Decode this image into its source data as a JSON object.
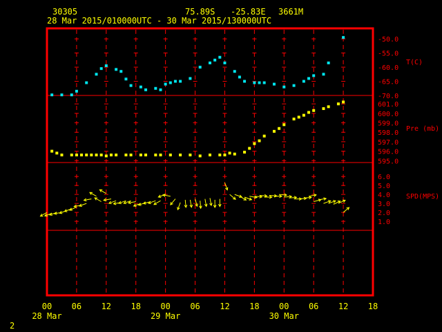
{
  "header": {
    "station_id": "30305",
    "lat": "75.89S",
    "lon": "-25.83E",
    "elevation": "3661M",
    "time_range": "28 Mar 2015/010000UTC - 30 Mar 2015/130000UTC"
  },
  "footer": {
    "page_number": "2"
  },
  "colors": {
    "background": "#000000",
    "frame": "#ff0000",
    "header_text": "#ffff00",
    "axis_text": "#ffff00",
    "temperature": "#00e5ee",
    "pressure": "#ffff00",
    "wind": "#ffff00"
  },
  "chart_data": {
    "type": "scatter",
    "x_unit": "hours since 28 Mar 2015 00 UTC",
    "x_range": [
      0,
      66
    ],
    "x_tick_labels": [
      "00",
      "06",
      "12",
      "18",
      "00",
      "06",
      "12",
      "18",
      "00",
      "06",
      "12",
      "18"
    ],
    "x_tick_values": [
      0,
      6,
      12,
      18,
      24,
      30,
      36,
      42,
      48,
      54,
      60,
      66
    ],
    "day_labels": [
      {
        "x": 0,
        "text": "28 Mar"
      },
      {
        "x": 24,
        "text": "29 Mar"
      },
      {
        "x": 48,
        "text": "30 Mar"
      }
    ],
    "panels": [
      {
        "id": "temperature",
        "label": "T(C)",
        "ylim": [
          -70,
          -48
        ],
        "y_ticks": [
          -50.0,
          -55.0,
          -60.0,
          -65.0,
          -70.0
        ],
        "y_tick_labels": [
          "-50.0",
          "-55.0",
          "-60.0",
          "-65.0",
          "-70.0"
        ],
        "x": [
          1,
          3,
          5,
          6,
          8,
          10,
          11,
          12,
          14,
          15,
          16,
          17,
          19,
          20,
          22,
          23,
          24,
          25,
          26,
          27,
          29,
          31,
          33,
          34,
          35,
          36,
          38,
          39,
          40,
          42,
          43,
          44,
          46,
          48,
          50,
          52,
          53,
          54,
          56,
          57,
          60
        ],
        "values": [
          -69.8,
          -69.8,
          -69.8,
          -68.5,
          -65.5,
          -62.5,
          -60.5,
          -59.5,
          -60.8,
          -61.5,
          -64.2,
          -66.5,
          -67.0,
          -68.0,
          -67.5,
          -68.0,
          -66.0,
          -65.5,
          -65.0,
          -65.0,
          -64.0,
          -60.0,
          -58.5,
          -57.5,
          -56.5,
          -58.5,
          -61.5,
          -63.5,
          -65.0,
          -65.5,
          -65.5,
          -65.5,
          -66.0,
          -67.0,
          -66.5,
          -65.0,
          -64.0,
          -63.0,
          -62.5,
          -58.5,
          -49.5
        ]
      },
      {
        "id": "pressure",
        "label": "Pre (mb)",
        "ylim": [
          594.8,
          601.6
        ],
        "y_ticks": [
          595.0,
          596.0,
          597.0,
          598.0,
          599.0,
          600.0,
          601.0
        ],
        "y_tick_labels": [
          "595.0",
          "596.0",
          "597.0",
          "598.0",
          "599.0",
          "600.0",
          "601.0"
        ],
        "x": [
          1,
          2,
          3,
          5,
          6,
          7,
          8,
          9,
          10,
          11,
          12,
          13,
          14,
          16,
          17,
          19,
          20,
          22,
          23,
          25,
          27,
          29,
          31,
          33,
          35,
          36,
          37,
          38,
          40,
          41,
          42,
          43,
          44,
          46,
          47,
          48,
          50,
          51,
          52,
          53,
          54,
          56,
          57,
          59,
          60
        ],
        "values": [
          596.0,
          595.8,
          595.6,
          595.6,
          595.6,
          595.6,
          595.6,
          595.6,
          595.6,
          595.6,
          595.5,
          595.6,
          595.6,
          595.6,
          595.6,
          595.6,
          595.6,
          595.6,
          595.6,
          595.6,
          595.6,
          595.6,
          595.5,
          595.6,
          595.6,
          595.6,
          595.8,
          595.7,
          595.9,
          596.3,
          596.8,
          597.1,
          597.6,
          598.1,
          598.4,
          598.8,
          599.4,
          599.6,
          599.8,
          600.1,
          600.3,
          600.5,
          600.7,
          601.0,
          601.2
        ]
      },
      {
        "id": "wind_speed",
        "label": "SPD(MPS)",
        "ylim": [
          0,
          6.4
        ],
        "y_ticks": [
          1.0,
          2.0,
          3.0,
          4.0,
          5.0,
          6.0
        ],
        "y_tick_labels": [
          "1.0",
          "2.0",
          "3.0",
          "4.0",
          "5.0",
          "6.0"
        ],
        "x": [
          0,
          1,
          2,
          3,
          4,
          5,
          6,
          7,
          8,
          9,
          10,
          11,
          12,
          13,
          14,
          15,
          16,
          17,
          18,
          19,
          20,
          21,
          22,
          23,
          24,
          25,
          26,
          27,
          28,
          29,
          30,
          31,
          32,
          33,
          34,
          35,
          36,
          37,
          38,
          39,
          40,
          41,
          42,
          43,
          44,
          45,
          46,
          47,
          48,
          49,
          50,
          51,
          52,
          53,
          54,
          55,
          56,
          57,
          58,
          59,
          60
        ],
        "values": [
          2.0,
          1.9,
          2.0,
          2.0,
          2.2,
          2.4,
          2.6,
          2.8,
          3.0,
          3.5,
          3.8,
          3.2,
          4.1,
          3.5,
          3.3,
          3.1,
          3.3,
          3.3,
          3.2,
          3.0,
          3.1,
          3.2,
          3.3,
          3.3,
          4.0,
          3.8,
          3.5,
          3.1,
          3.4,
          3.4,
          3.5,
          3.3,
          3.5,
          3.6,
          3.4,
          3.5,
          5.3,
          4.0,
          4.0,
          3.8,
          3.7,
          3.8,
          3.8,
          3.9,
          3.7,
          3.9,
          3.8,
          4.0,
          3.7,
          3.6,
          3.5,
          3.5,
          3.6,
          3.8,
          3.2,
          3.4,
          3.0,
          3.0,
          2.9,
          3.0,
          2.0
        ],
        "direction_deg": [
          240,
          250,
          250,
          260,
          250,
          250,
          245,
          260,
          250,
          260,
          300,
          300,
          300,
          260,
          250,
          260,
          250,
          250,
          260,
          250,
          250,
          255,
          250,
          240,
          250,
          280,
          220,
          200,
          175,
          170,
          165,
          175,
          170,
          170,
          180,
          180,
          160,
          130,
          110,
          120,
          110,
          100,
          95,
          95,
          90,
          95,
          90,
          95,
          85,
          85,
          90,
          85,
          85,
          80,
          75,
          80,
          70,
          70,
          65,
          65,
          50
        ]
      }
    ]
  }
}
